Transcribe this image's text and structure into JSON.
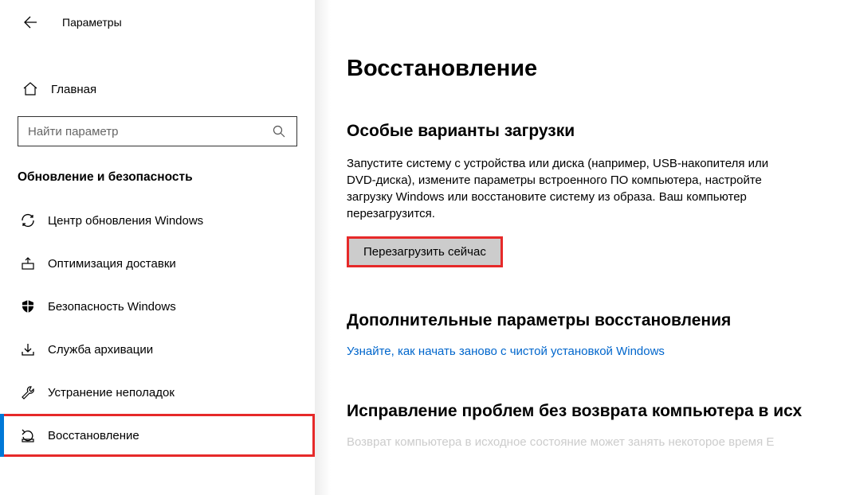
{
  "header": {
    "app_title": "Параметры"
  },
  "sidebar": {
    "home_label": "Главная",
    "search_placeholder": "Найти параметр",
    "category_title": "Обновление и безопасность",
    "items": [
      {
        "label": "Центр обновления Windows"
      },
      {
        "label": "Оптимизация доставки"
      },
      {
        "label": "Безопасность Windows"
      },
      {
        "label": "Служба архивации"
      },
      {
        "label": "Устранение неполадок"
      },
      {
        "label": "Восстановление"
      }
    ]
  },
  "main": {
    "page_title": "Восстановление",
    "section1": {
      "heading": "Особые варианты загрузки",
      "desc": "Запустите систему с устройства или диска (например, USB-накопителя или DVD-диска), измените параметры встроенного ПО компьютера, настройте загрузку Windows или восстановите систему из образа. Ваш компьютер перезагрузится.",
      "button": "Перезагрузить сейчас"
    },
    "section2": {
      "heading": "Дополнительные параметры восстановления",
      "link": "Узнайте, как начать заново с чистой установкой Windows"
    },
    "section3": {
      "heading": "Исправление проблем без возврата компьютера в исх",
      "desc": "Возврат компьютера в исходное состояние может занять некоторое время  Е"
    }
  }
}
